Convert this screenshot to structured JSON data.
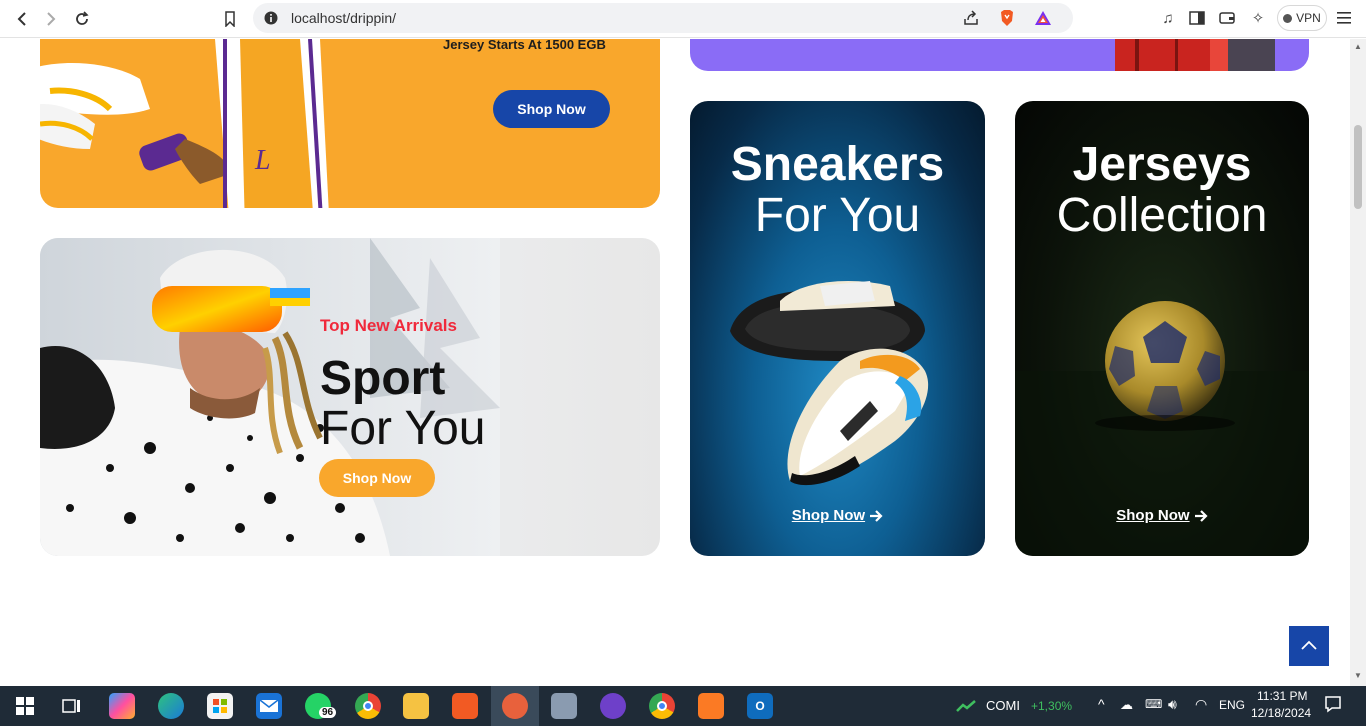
{
  "browser": {
    "url": "localhost/drippin/",
    "vpn_label": "VPN"
  },
  "cards": {
    "jersey_promo": {
      "price_text": "Jersey Starts At 1500 EGB",
      "button_label": "Shop Now",
      "color": "#f9a72c",
      "button_color": "#1746a8"
    },
    "sport": {
      "tag": "Top New Arrivals",
      "title": "Sport",
      "subtitle": "For You",
      "button_label": "Shop Now",
      "tag_color": "#f0293b",
      "button_color": "#f9a72c"
    },
    "sneakers": {
      "title": "Sneakers",
      "subtitle": "For You",
      "link_label": "Shop Now"
    },
    "jerseys": {
      "title": "Jerseys",
      "subtitle": "Collection",
      "link_label": "Shop Now"
    }
  },
  "taskbar": {
    "whatsapp_badge": "96",
    "stock_name": "COMI",
    "stock_change": "+1,30%",
    "language": "ENG",
    "time": "11:31 PM",
    "date": "12/18/2024"
  }
}
